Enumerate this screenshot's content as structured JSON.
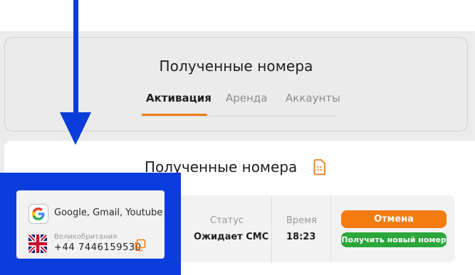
{
  "header": {
    "title": "Полученные номера",
    "tabs": [
      {
        "label": "Активация",
        "active": true
      },
      {
        "label": "Аренда",
        "active": false
      },
      {
        "label": "Аккаунты",
        "active": false
      }
    ]
  },
  "content": {
    "title": "Полученные номера",
    "order": {
      "service": "Google, Gmail, Youtube",
      "country": "Великобритания",
      "phone": "+44 7446159530",
      "status_label": "Статус",
      "status_value": "Ожидает СМС",
      "time_label": "Время",
      "time_value": "18:23",
      "cancel_button": "Отмена",
      "new_number_button": "Получить новый номер"
    }
  },
  "colors": {
    "accent": "#f07d12",
    "cancel": "#f47b0d",
    "success": "#2ba63a",
    "highlight": "#0a3ddc"
  },
  "icons": [
    "arrow-down-icon",
    "sim-card-icon",
    "google-icon",
    "uk-flag-icon",
    "copy-icon"
  ]
}
